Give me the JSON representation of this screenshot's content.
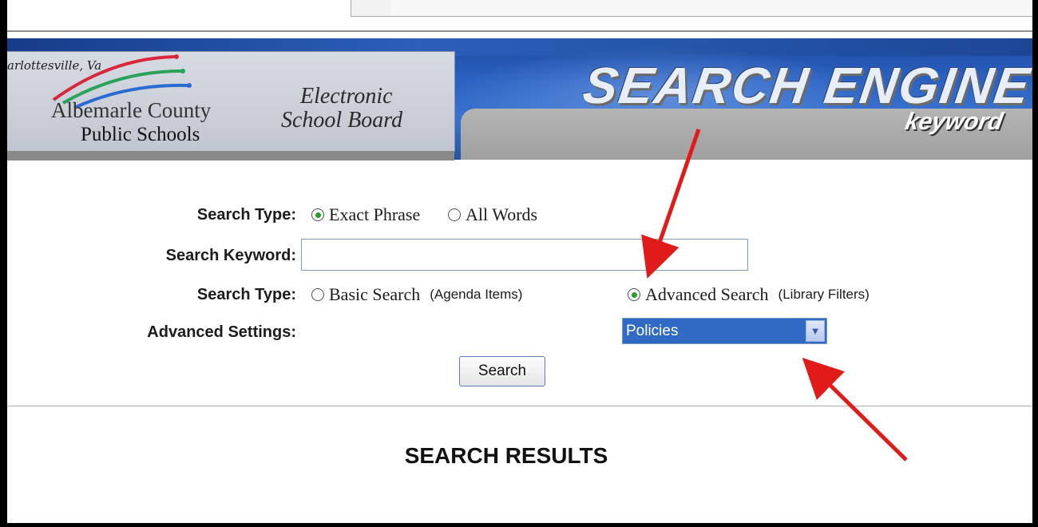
{
  "header": {
    "city": "arlottesville, Va",
    "org_line1": "Albemarle County",
    "org_line2": "Public Schools",
    "board_line1": "Electronic",
    "board_line2": "School Board",
    "title": "SEARCH ENGINE",
    "subtitle": "keyword"
  },
  "form": {
    "search_type_label": "Search Type:",
    "search_type_options": [
      "Exact Phrase",
      "All Words"
    ],
    "search_type_selected": "Exact Phrase",
    "keyword_label": "Search Keyword:",
    "keyword_value": "",
    "mode_label": "Search Type:",
    "basic_option": "Basic Search",
    "basic_hint": "(Agenda Items)",
    "advanced_option": "Advanced Search",
    "advanced_hint": "(Library Filters)",
    "mode_selected": "Advanced Search",
    "advanced_settings_label": "Advanced Settings:",
    "advanced_settings_value": "Policies",
    "search_button": "Search"
  },
  "results": {
    "heading": "SEARCH RESULTS"
  },
  "colors": {
    "banner_blue": "#2b62c2",
    "select_highlight": "#316ac5",
    "annotation_arrow": "#e11a1a",
    "radio_dot": "#2a9a2a"
  }
}
